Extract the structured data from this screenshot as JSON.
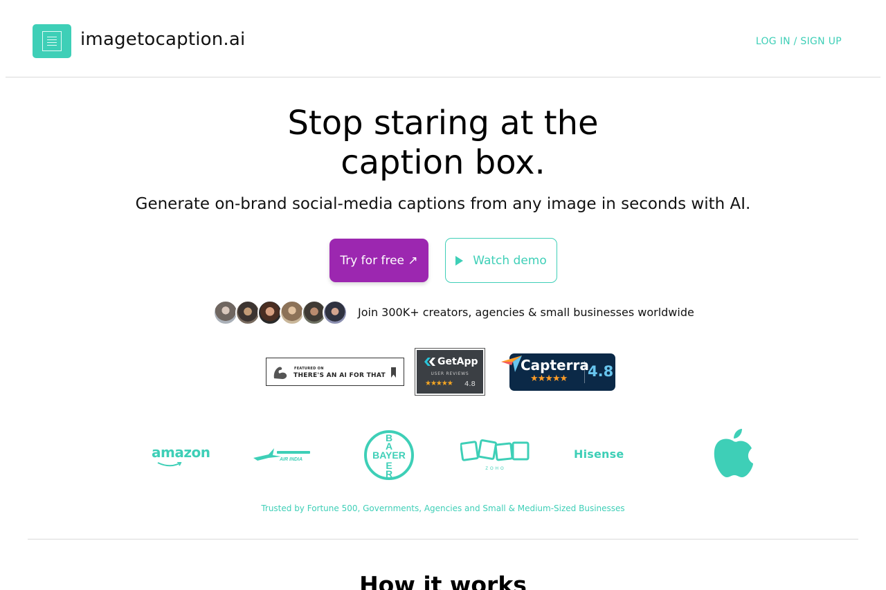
{
  "header": {
    "brand": "imagetocaption.ai",
    "login_label": "LOG IN / SIGN UP"
  },
  "hero": {
    "title_line1": "Stop staring at the",
    "title_line2": "caption box.",
    "subtitle": "Generate on-brand social-media captions from any image in seconds with AI.",
    "try_label": "Try for free ↗",
    "demo_label": "Watch demo"
  },
  "social_proof": {
    "join_text": "Join 300K+ creators, agencies & small businesses worldwide"
  },
  "badges": {
    "aift_small": "FEATURED ON",
    "aift_main": "THERE'S AN AI FOR THAT",
    "getapp_name": "GetApp",
    "getapp_sub": "USER REVIEWS",
    "getapp_stars": "★★★★★",
    "getapp_rating": "4.8",
    "capterra_name": "Capterra",
    "capterra_stars": "★★★★★",
    "capterra_rating": "4.8"
  },
  "clients": {
    "amazon": "amazon",
    "hisense": "Hisense",
    "bayer": "BAYER",
    "zoho": "ZOHO",
    "airindia": "AIR INDIA",
    "trusted_text": "Trusted by Fortune 500, Governments, Agencies and Small & Medium-Sized Businesses"
  },
  "section": {
    "how_title": "How it works"
  },
  "colors": {
    "accent": "#3ecfb7",
    "primary_button": "#9c27b0",
    "capterra_bg": "#0b2947",
    "getapp_bg": "#3b3f44"
  }
}
